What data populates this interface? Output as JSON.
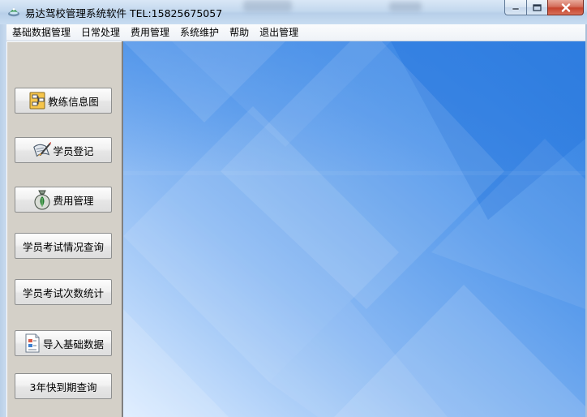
{
  "window": {
    "title": "易达驾校管理系统软件 TEL:15825675057"
  },
  "menu": [
    {
      "label": "基础数据管理"
    },
    {
      "label": "日常处理"
    },
    {
      "label": "费用管理"
    },
    {
      "label": "系统维护"
    },
    {
      "label": "帮助"
    },
    {
      "label": "退出管理"
    }
  ],
  "sidebar": {
    "buttons": [
      {
        "label": "教练信息图",
        "icon": "organization-chart-icon"
      },
      {
        "label": "学员登记",
        "icon": "writing-scroll-icon"
      },
      {
        "label": "费用管理",
        "icon": "money-bag-icon"
      },
      {
        "label": "学员考试情况查询",
        "icon": ""
      },
      {
        "label": "学员考试次数统计",
        "icon": ""
      },
      {
        "label": "导入基础数据",
        "icon": "import-document-icon"
      },
      {
        "label": "3年快到期查询",
        "icon": ""
      }
    ]
  },
  "colors": {
    "background_blue": "#2f7fe0",
    "sidebar_gray": "#d4d0c8",
    "close_red": "#c6432c"
  }
}
